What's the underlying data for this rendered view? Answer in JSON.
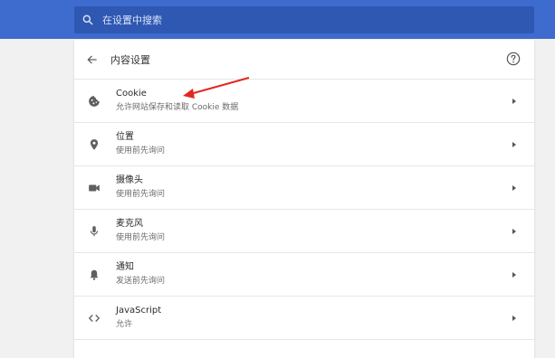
{
  "search": {
    "placeholder": "在设置中搜索",
    "icon": "search-icon"
  },
  "header": {
    "title": "内容设置",
    "back_icon": "arrow-left-icon",
    "help_icon": "help-circle-icon"
  },
  "colors": {
    "topbar": "#3d6bce",
    "search_bg": "#2f58b3",
    "annotation_arrow": "#e3271f"
  },
  "items": [
    {
      "label": "Cookie",
      "sub": "允许网站保存和读取 Cookie 数据",
      "icon": "cookie-icon"
    },
    {
      "label": "位置",
      "sub": "使用前先询问",
      "icon": "location-pin-icon"
    },
    {
      "label": "摄像头",
      "sub": "使用前先询问",
      "icon": "camera-icon"
    },
    {
      "label": "麦克风",
      "sub": "使用前先询问",
      "icon": "microphone-icon"
    },
    {
      "label": "通知",
      "sub": "发送前先询问",
      "icon": "bell-icon"
    },
    {
      "label": "JavaScript",
      "sub": "允许",
      "icon": "code-brackets-icon"
    }
  ]
}
